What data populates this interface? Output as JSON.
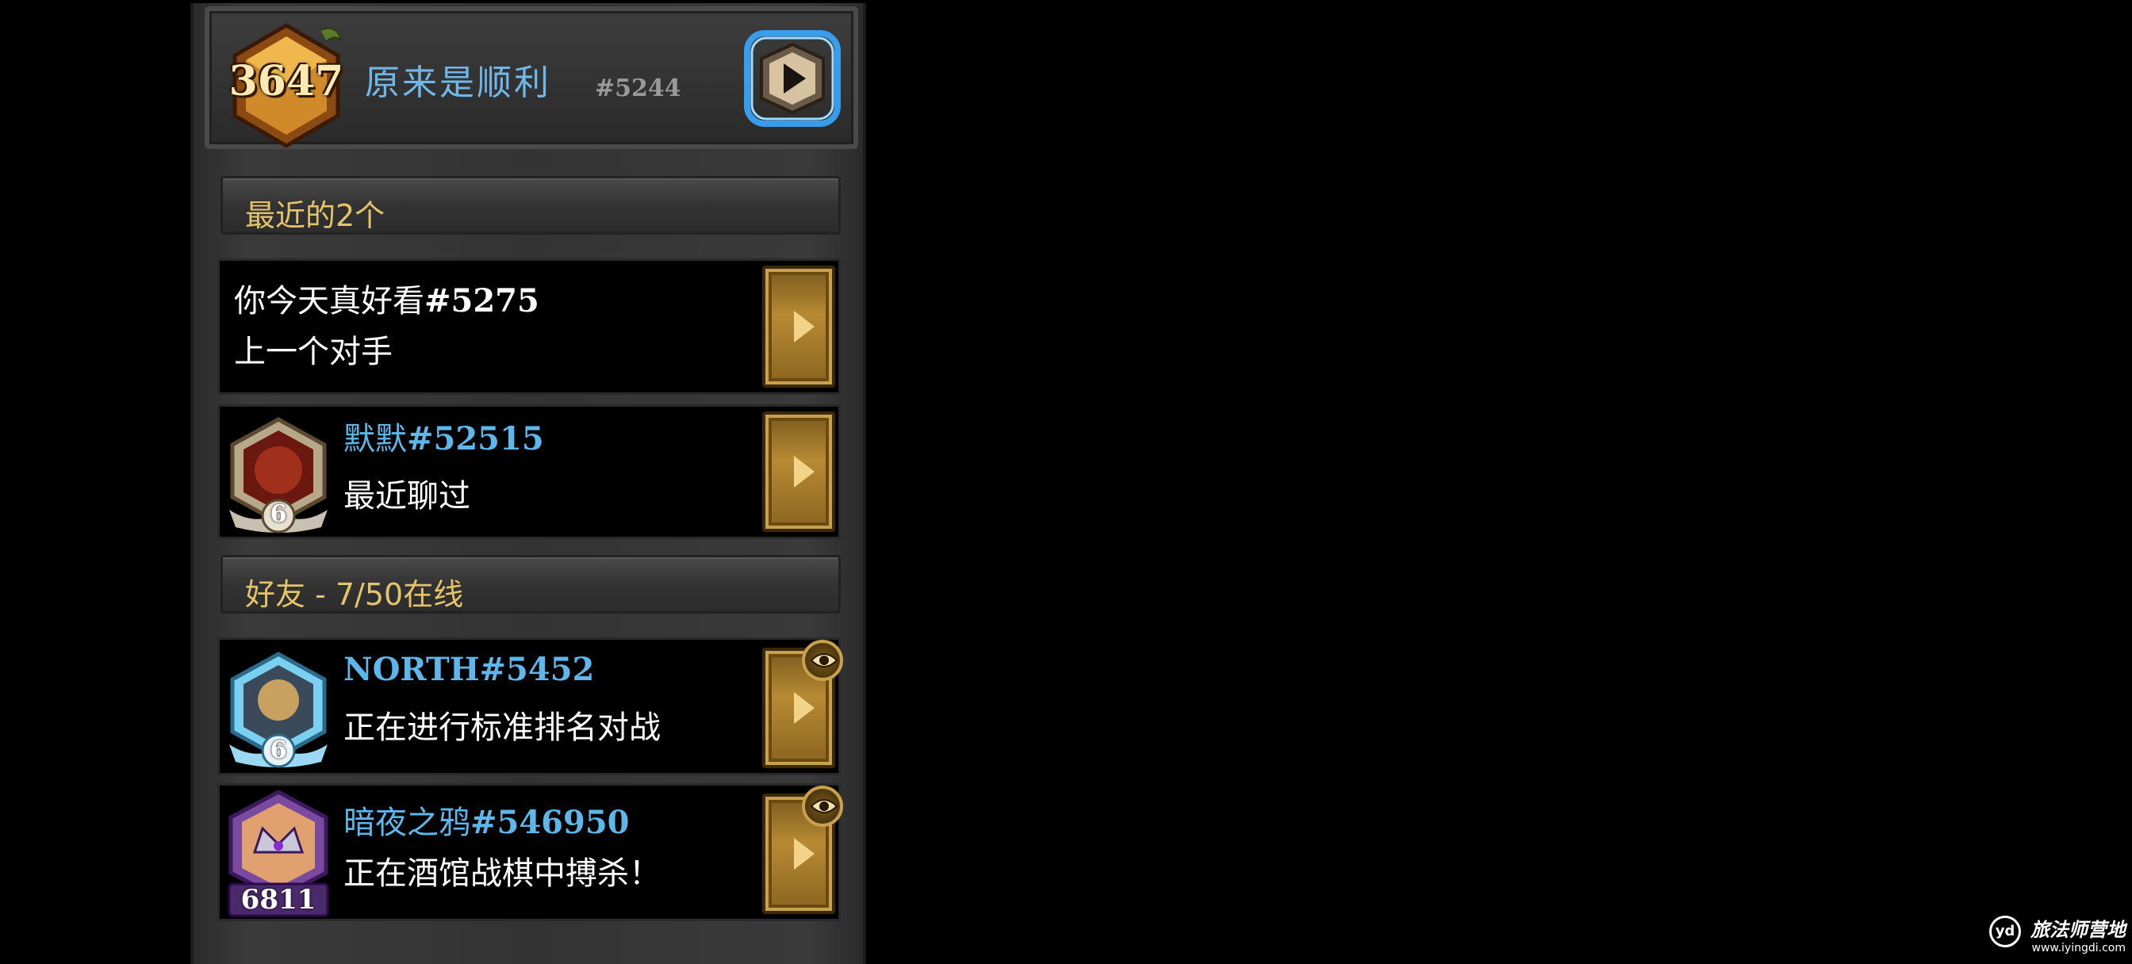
{
  "header": {
    "rank_value": "3647",
    "player_name": "原来是顺利",
    "player_tag": "#5244"
  },
  "sections": {
    "recent_title": "最近的2个",
    "friends_title": "好友 - 7/50在线"
  },
  "recent": [
    {
      "name": "你今天真好看",
      "tag": "#5275",
      "status": "上一个对手"
    },
    {
      "name": "默默",
      "tag": "#52515",
      "status": "最近聊过",
      "avatar_level": "6"
    }
  ],
  "friends": [
    {
      "name": "NORTH",
      "tag": "#5452",
      "status": "正在进行标准排名对战",
      "avatar_level": "6"
    },
    {
      "name": "暗夜之鸦",
      "tag": "#546950",
      "status": "正在酒馆战棋中搏杀！",
      "avatar_level": "6811"
    }
  ],
  "watermark": {
    "logo": "yd",
    "title": "旅法师营地",
    "url": "www.iyingdi.com"
  },
  "colors": {
    "section_gold": "#e3c46a",
    "name_blue": "#5db7ea",
    "button_gold": "#b78a34"
  },
  "icons": [
    "rank-gem-icon",
    "play-icon",
    "arrow-right-icon",
    "eye-icon",
    "avatar-icon"
  ]
}
